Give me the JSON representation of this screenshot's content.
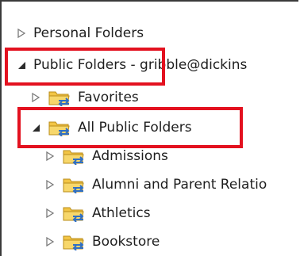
{
  "tree": {
    "items": [
      {
        "label": "Personal Folders",
        "expanded": false,
        "has_folder_icon": false
      },
      {
        "label": "Public Folders - gribble@dickins",
        "expanded": true,
        "has_folder_icon": false
      },
      {
        "label": "Favorites",
        "expanded": false,
        "has_folder_icon": true
      },
      {
        "label": "All Public Folders",
        "expanded": true,
        "has_folder_icon": true
      },
      {
        "label": "Admissions",
        "expanded": false,
        "has_folder_icon": true
      },
      {
        "label": "Alumni and Parent Relatio",
        "expanded": false,
        "has_folder_icon": true
      },
      {
        "label": "Athletics",
        "expanded": false,
        "has_folder_icon": true
      },
      {
        "label": "Bookstore",
        "expanded": false,
        "has_folder_icon": true
      }
    ]
  },
  "icons": {
    "collapsed_arrow": "triangle-right-outline-icon",
    "expanded_arrow": "triangle-down-filled-icon",
    "folder": "public-folder-icon"
  },
  "colors": {
    "highlight_border": "#e3111f",
    "frame_border": "#3a3a3a",
    "text": "#1e1e1e",
    "folder_yellow": "#f2c545",
    "folder_arrow_blue": "#2f6fc4"
  }
}
